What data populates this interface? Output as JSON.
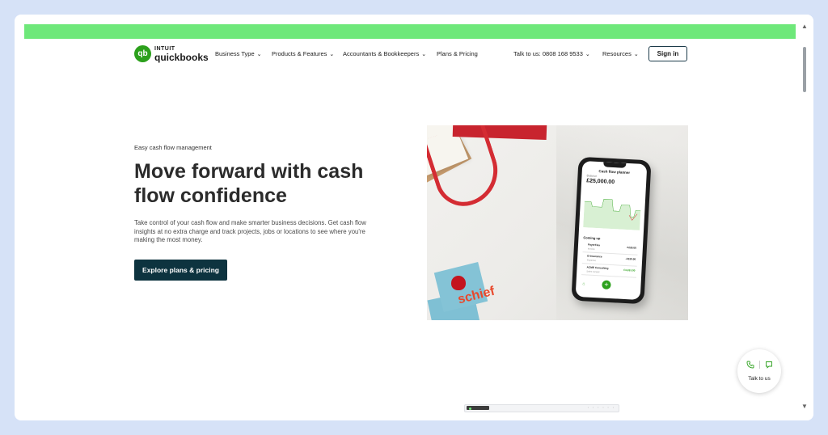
{
  "nav": {
    "logo_intuit": "INTUIT",
    "logo_product": "quickbooks",
    "logo_mark": "qb",
    "items": [
      {
        "label": "Business Type"
      },
      {
        "label": "Products & Features"
      },
      {
        "label": "Accountants & Bookkeepers"
      },
      {
        "label": "Plans & Pricing"
      }
    ],
    "phone": "Talk to us: 0808 168 9533",
    "resources": "Resources",
    "signin": "Sign in"
  },
  "hero": {
    "eyebrow": "Easy cash flow management",
    "headline": "Move forward with cash flow confidence",
    "body": "Take control of your cash flow and make smarter business decisions. Get cash flow insights at no extra charge and track projects, jobs or locations to see where you're making the most money.",
    "cta": "Explore plans & pricing"
  },
  "phone_screen": {
    "title": "Cash flow planner",
    "balance_label": "Balance",
    "amount": "£25,000.00",
    "coming_up": "Coming up",
    "rows": [
      {
        "name": "PayerFlex",
        "meta": "Invoice",
        "amount": "£230.00",
        "positive": false
      },
      {
        "name": "E-Insurance",
        "meta": "Expense",
        "amount": "-£230.00",
        "positive": false
      },
      {
        "name": "ACME Consulting",
        "meta": "Sales receipt",
        "amount": "£3,333.00",
        "positive": true
      }
    ],
    "fab": "+"
  },
  "sticky_note_text": "schief",
  "talk_widget": {
    "label": "Talk to us",
    "icons": [
      "phone-icon",
      "chat-icon"
    ]
  },
  "colors": {
    "brand_green": "#2ca01c",
    "cta_bg": "#0d333f",
    "top_bar": "#6ee87a"
  }
}
